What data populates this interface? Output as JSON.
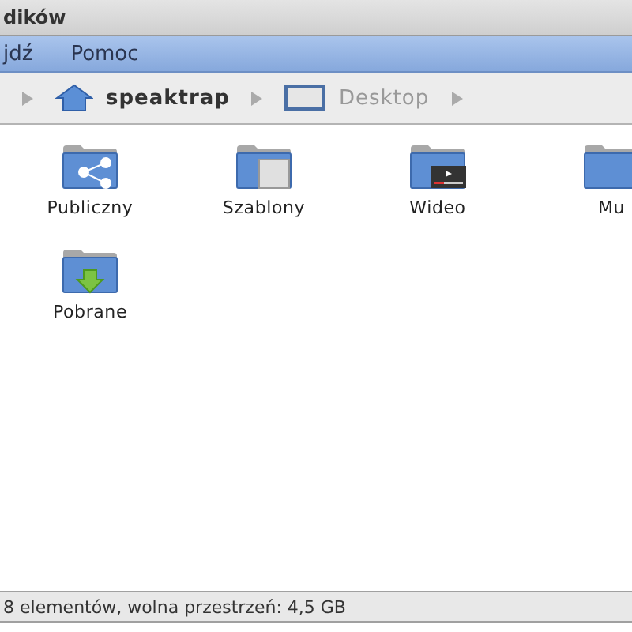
{
  "window": {
    "title": "dików"
  },
  "menu": [
    {
      "label": "jdź"
    },
    {
      "label": "Pomoc"
    }
  ],
  "path_bar": [
    {
      "label": "speaktrap",
      "kind": "home",
      "selected": true
    },
    {
      "label": "Desktop",
      "kind": "desktop",
      "selected": false
    }
  ],
  "folders": [
    {
      "label": "Publiczny",
      "kind": "share"
    },
    {
      "label": "Szablony",
      "kind": "template"
    },
    {
      "label": "Wideo",
      "kind": "video"
    },
    {
      "label": "Mu",
      "kind": "plain"
    },
    {
      "label": "Pobrane",
      "kind": "download"
    }
  ],
  "status_bar": "8 elementów, wolna przestrzeń: 4,5 GB"
}
